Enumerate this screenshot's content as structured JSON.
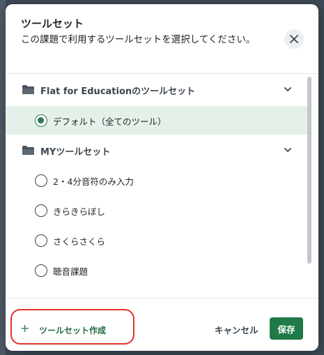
{
  "dialog": {
    "title": "ツールセット",
    "subtitle": "この課題で利用するツールセットを選択してください。"
  },
  "groups": [
    {
      "label": "Flat for Educationのツールセット",
      "options": [
        {
          "label": "デフォルト（全てのツール）",
          "selected": true
        }
      ]
    },
    {
      "label": "MYツールセット",
      "options": [
        {
          "label": "2・4分音符のみ入力",
          "selected": false
        },
        {
          "label": "きらきらぼし",
          "selected": false
        },
        {
          "label": "さくらさくら",
          "selected": false
        },
        {
          "label": "聴音課題",
          "selected": false
        }
      ]
    }
  ],
  "footer": {
    "create_label": "ツールセット作成",
    "cancel_label": "キャンセル",
    "save_label": "保存"
  },
  "icons": {
    "close": "close-icon",
    "folder": "folder-icon",
    "chevron": "chevron-down-icon",
    "plus": "plus-icon"
  },
  "colors": {
    "accent": "#1f7a47",
    "selected_bg": "#e5f0e9",
    "highlight": "#e0342c"
  }
}
